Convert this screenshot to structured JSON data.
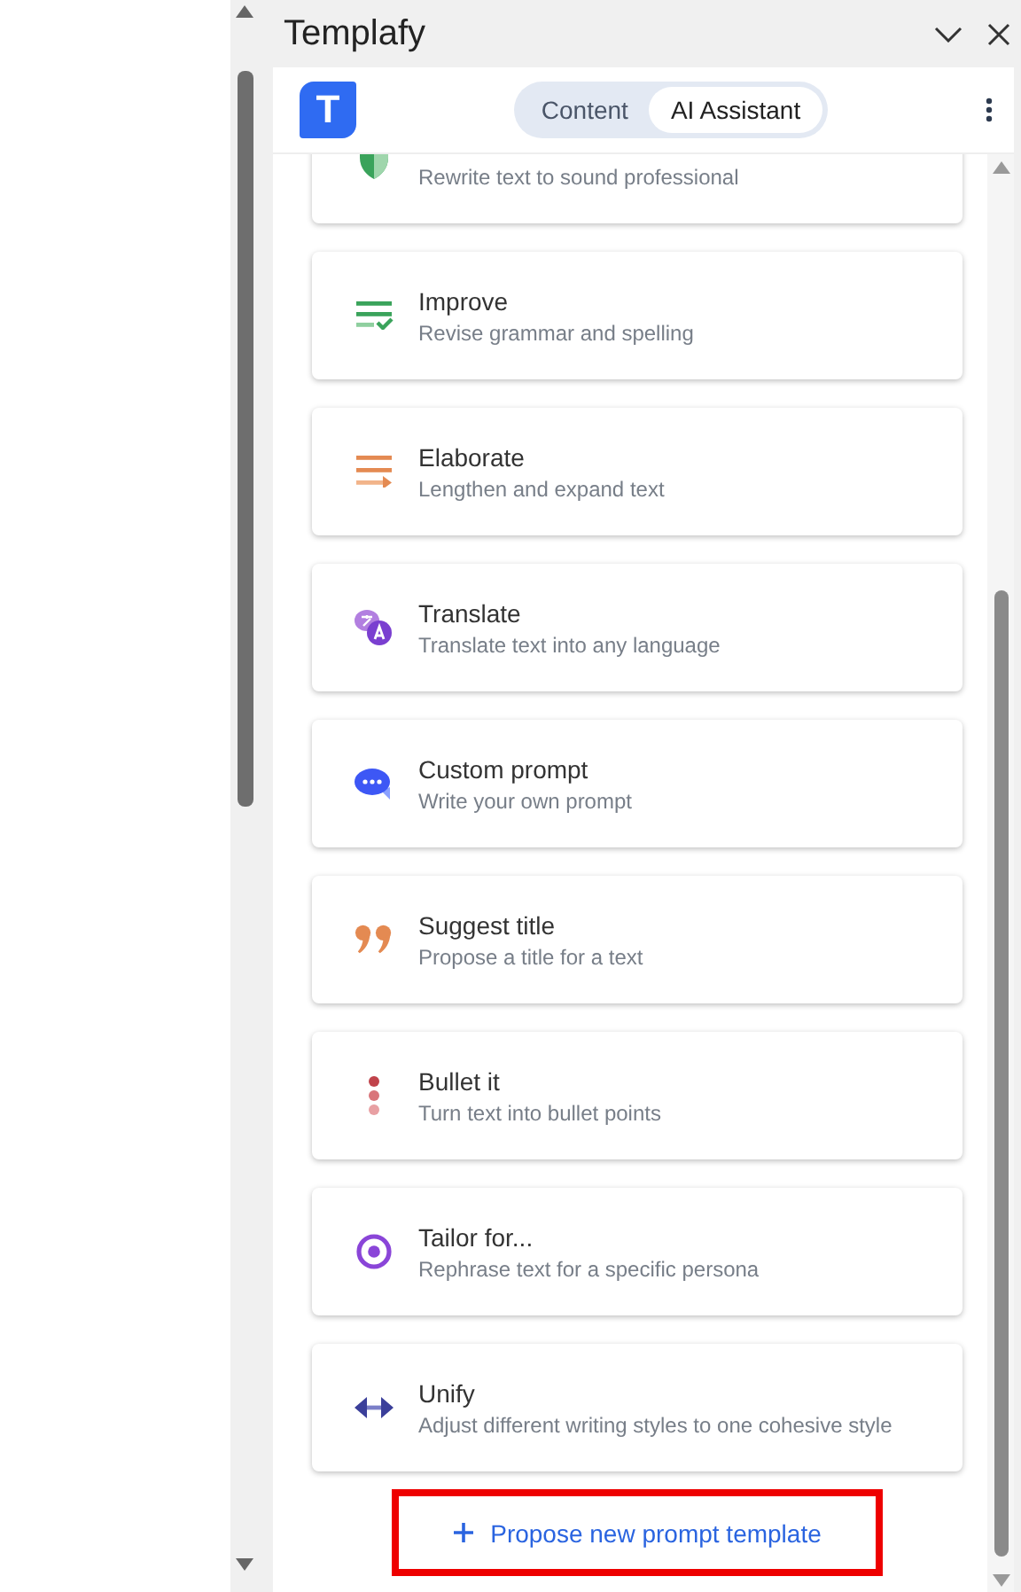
{
  "pane": {
    "title": "Templafy"
  },
  "tabs": [
    {
      "label": "Content",
      "selected": false
    },
    {
      "label": "AI Assistant",
      "selected": true
    }
  ],
  "logo": "T",
  "prompts": [
    {
      "kind": "shield",
      "description": "Rewrite text to sound professional"
    },
    {
      "kind": "improve",
      "title": "Improve",
      "description": "Revise grammar and spelling"
    },
    {
      "kind": "elaborate",
      "title": "Elaborate",
      "description": "Lengthen and expand text"
    },
    {
      "kind": "translate",
      "title": "Translate",
      "description": "Translate text into any language"
    },
    {
      "kind": "custom",
      "title": "Custom prompt",
      "description": "Write your own prompt"
    },
    {
      "kind": "title",
      "title": "Suggest title",
      "description": "Propose a title for a text"
    },
    {
      "kind": "bullet",
      "title": "Bullet it",
      "description": "Turn text into bullet points"
    },
    {
      "kind": "tailor",
      "title": "Tailor for...",
      "description": "Rephrase text for a specific persona"
    },
    {
      "kind": "unify",
      "title": "Unify",
      "description": "Adjust different writing styles to one cohesive style"
    }
  ],
  "propose": {
    "label": "Propose new prompt template",
    "highlighted": true
  }
}
